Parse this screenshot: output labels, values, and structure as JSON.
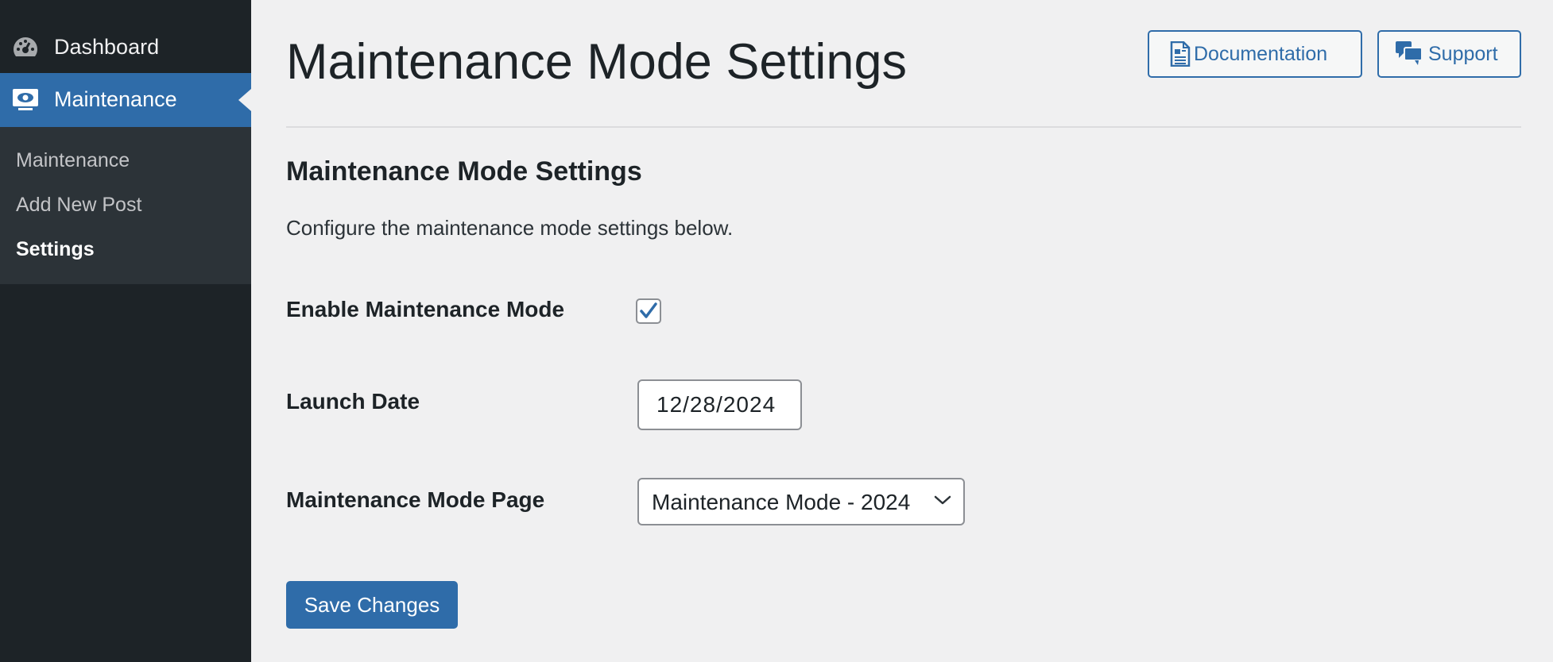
{
  "sidebar": {
    "dashboard_label": "Dashboard",
    "active_label": "Maintenance",
    "submenu": [
      {
        "label": "Maintenance"
      },
      {
        "label": "Add New Post"
      },
      {
        "label": "Settings"
      }
    ]
  },
  "header": {
    "title": "Maintenance Mode Settings",
    "documentation_label": "Documentation",
    "support_label": "Support"
  },
  "section": {
    "title": "Maintenance Mode Settings",
    "description": "Configure the maintenance mode settings below."
  },
  "form": {
    "enable_label": "Enable Maintenance Mode",
    "enable_checked": true,
    "launch_date_label": "Launch Date",
    "launch_date_value": "12/28/2024",
    "page_label": "Maintenance Mode Page",
    "page_selected": "Maintenance Mode - 2024",
    "save_label": "Save Changes"
  },
  "icons": {
    "dashboard": "dashboard-gauge-icon",
    "maintenance": "monitor-eye-icon",
    "documentation": "document-icon",
    "support": "speech-bubbles-icon",
    "checkmark": "checkmark-icon",
    "chevron": "chevron-down-icon"
  },
  "colors": {
    "sidebar_bg": "#1d2327",
    "submenu_bg": "#2c3338",
    "accent": "#2f6ca9",
    "page_bg": "#f0f0f1"
  }
}
